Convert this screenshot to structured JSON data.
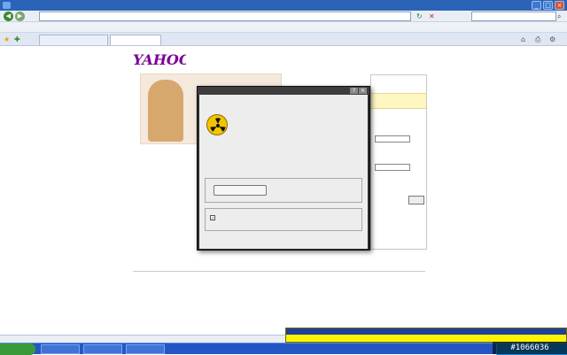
{
  "window": {
    "title": ""
  },
  "address_bar": {
    "url": "",
    "search_placeholder": ""
  },
  "menu": {
    "items": [
      "",
      "",
      "",
      "",
      "",
      ""
    ]
  },
  "tabs": [
    {
      "label": ""
    },
    {
      "label": ""
    }
  ],
  "page": {
    "logo_text": "YAHOO!",
    "logo_sub": "",
    "toplinks": "",
    "banner_red": "",
    "sections": [
      {
        "title": "",
        "body": ""
      },
      {
        "title": "",
        "body": ""
      },
      {
        "title": "",
        "body": ""
      },
      {
        "title": "",
        "body": ""
      }
    ],
    "login": {
      "header": "",
      "notice": "",
      "button": ""
    },
    "footer": {
      "line1": "",
      "line2": "",
      "line3": ""
    }
  },
  "dialog": {
    "titlebar": "",
    "heading": "",
    "description": "",
    "fields": [
      {
        "key": "",
        "value": ""
      },
      {
        "key": "",
        "value": ""
      },
      {
        "key": "",
        "value": ""
      },
      {
        "key": "",
        "value": ""
      }
    ],
    "group1_label": "",
    "action_button": "",
    "group2_label": "",
    "checkbox1": "",
    "checkbox2": "",
    "footer_link": "",
    "settings_link": ""
  },
  "statusbar": {
    "text": ""
  },
  "avast": {
    "header": "",
    "message": ""
  },
  "taskbar": {
    "start": "",
    "tasks": [
      "",
      "",
      ""
    ]
  },
  "watermark": "#1066036",
  "colors": {
    "xp_blue": "#2457c4",
    "yahoo_purple": "#7b0099",
    "alert_yellow": "#fff400"
  }
}
